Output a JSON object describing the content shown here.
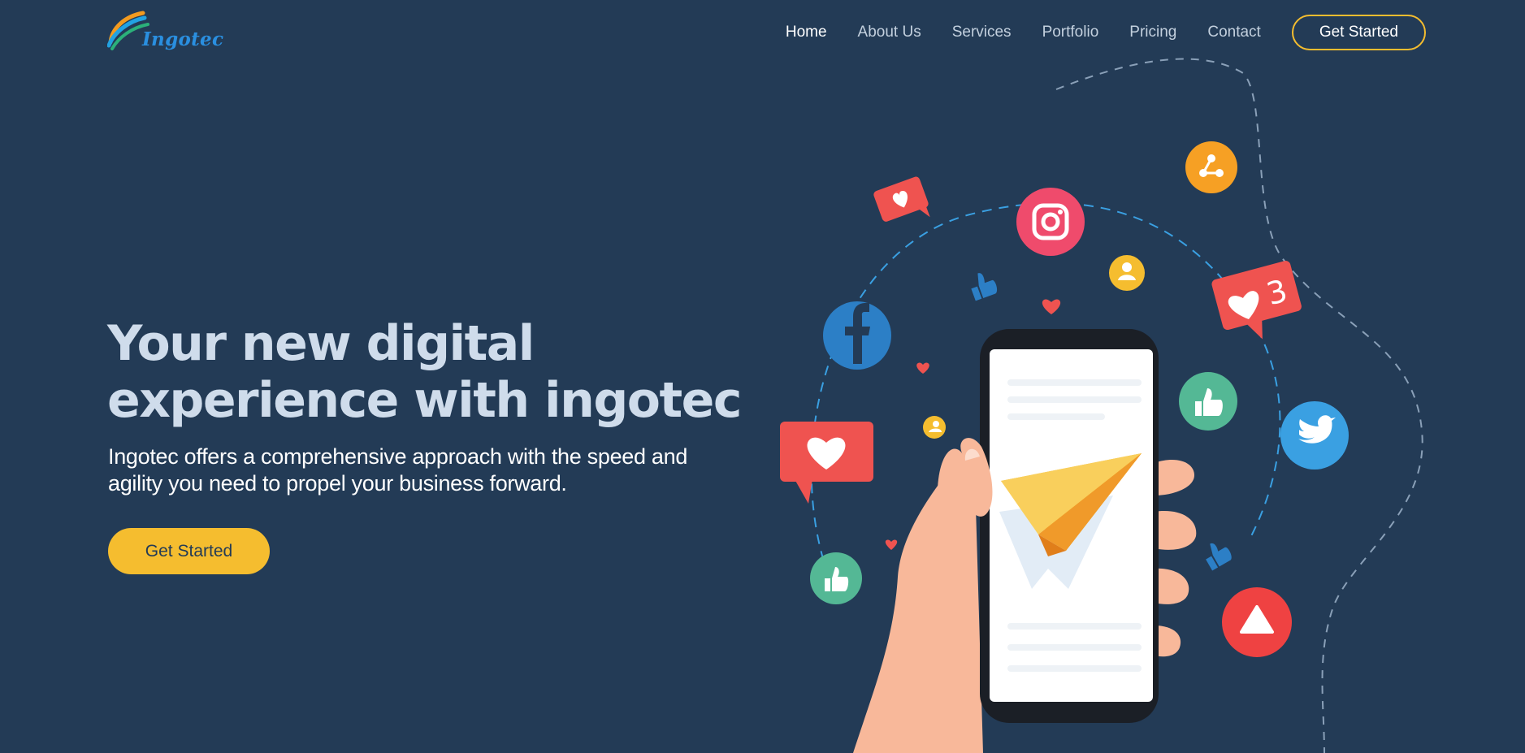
{
  "brand": {
    "name": "Ingotec"
  },
  "nav": {
    "items": [
      {
        "label": "Home",
        "active": true
      },
      {
        "label": "About Us"
      },
      {
        "label": "Services"
      },
      {
        "label": "Portfolio"
      },
      {
        "label": "Pricing"
      },
      {
        "label": "Contact"
      }
    ],
    "cta_label": "Get Started"
  },
  "hero": {
    "title_line1": "Your new digital",
    "title_line2": "experience with ingotec",
    "subtitle_line1": "Ingotec offers a comprehensive approach with the speed and",
    "subtitle_line2": "agility you need to propel your business forward.",
    "cta_label": "Get Started"
  },
  "illustration": {
    "like_count": "3",
    "icons": [
      "facebook-icon",
      "instagram-icon",
      "twitter-icon",
      "share-icon",
      "youtube-play-icon",
      "heart-icon",
      "thumbs-up-icon",
      "user-icon",
      "paper-plane-icon"
    ]
  },
  "colors": {
    "background": "#233b56",
    "accent": "#f5bd2f",
    "title": "#cfdceb",
    "heart_red": "#ef5350",
    "facebook": "#2c7fc6",
    "instagram": "#ef4b6c",
    "twitter": "#3aa0e2",
    "green": "#54b895",
    "orange": "#f6a024"
  }
}
